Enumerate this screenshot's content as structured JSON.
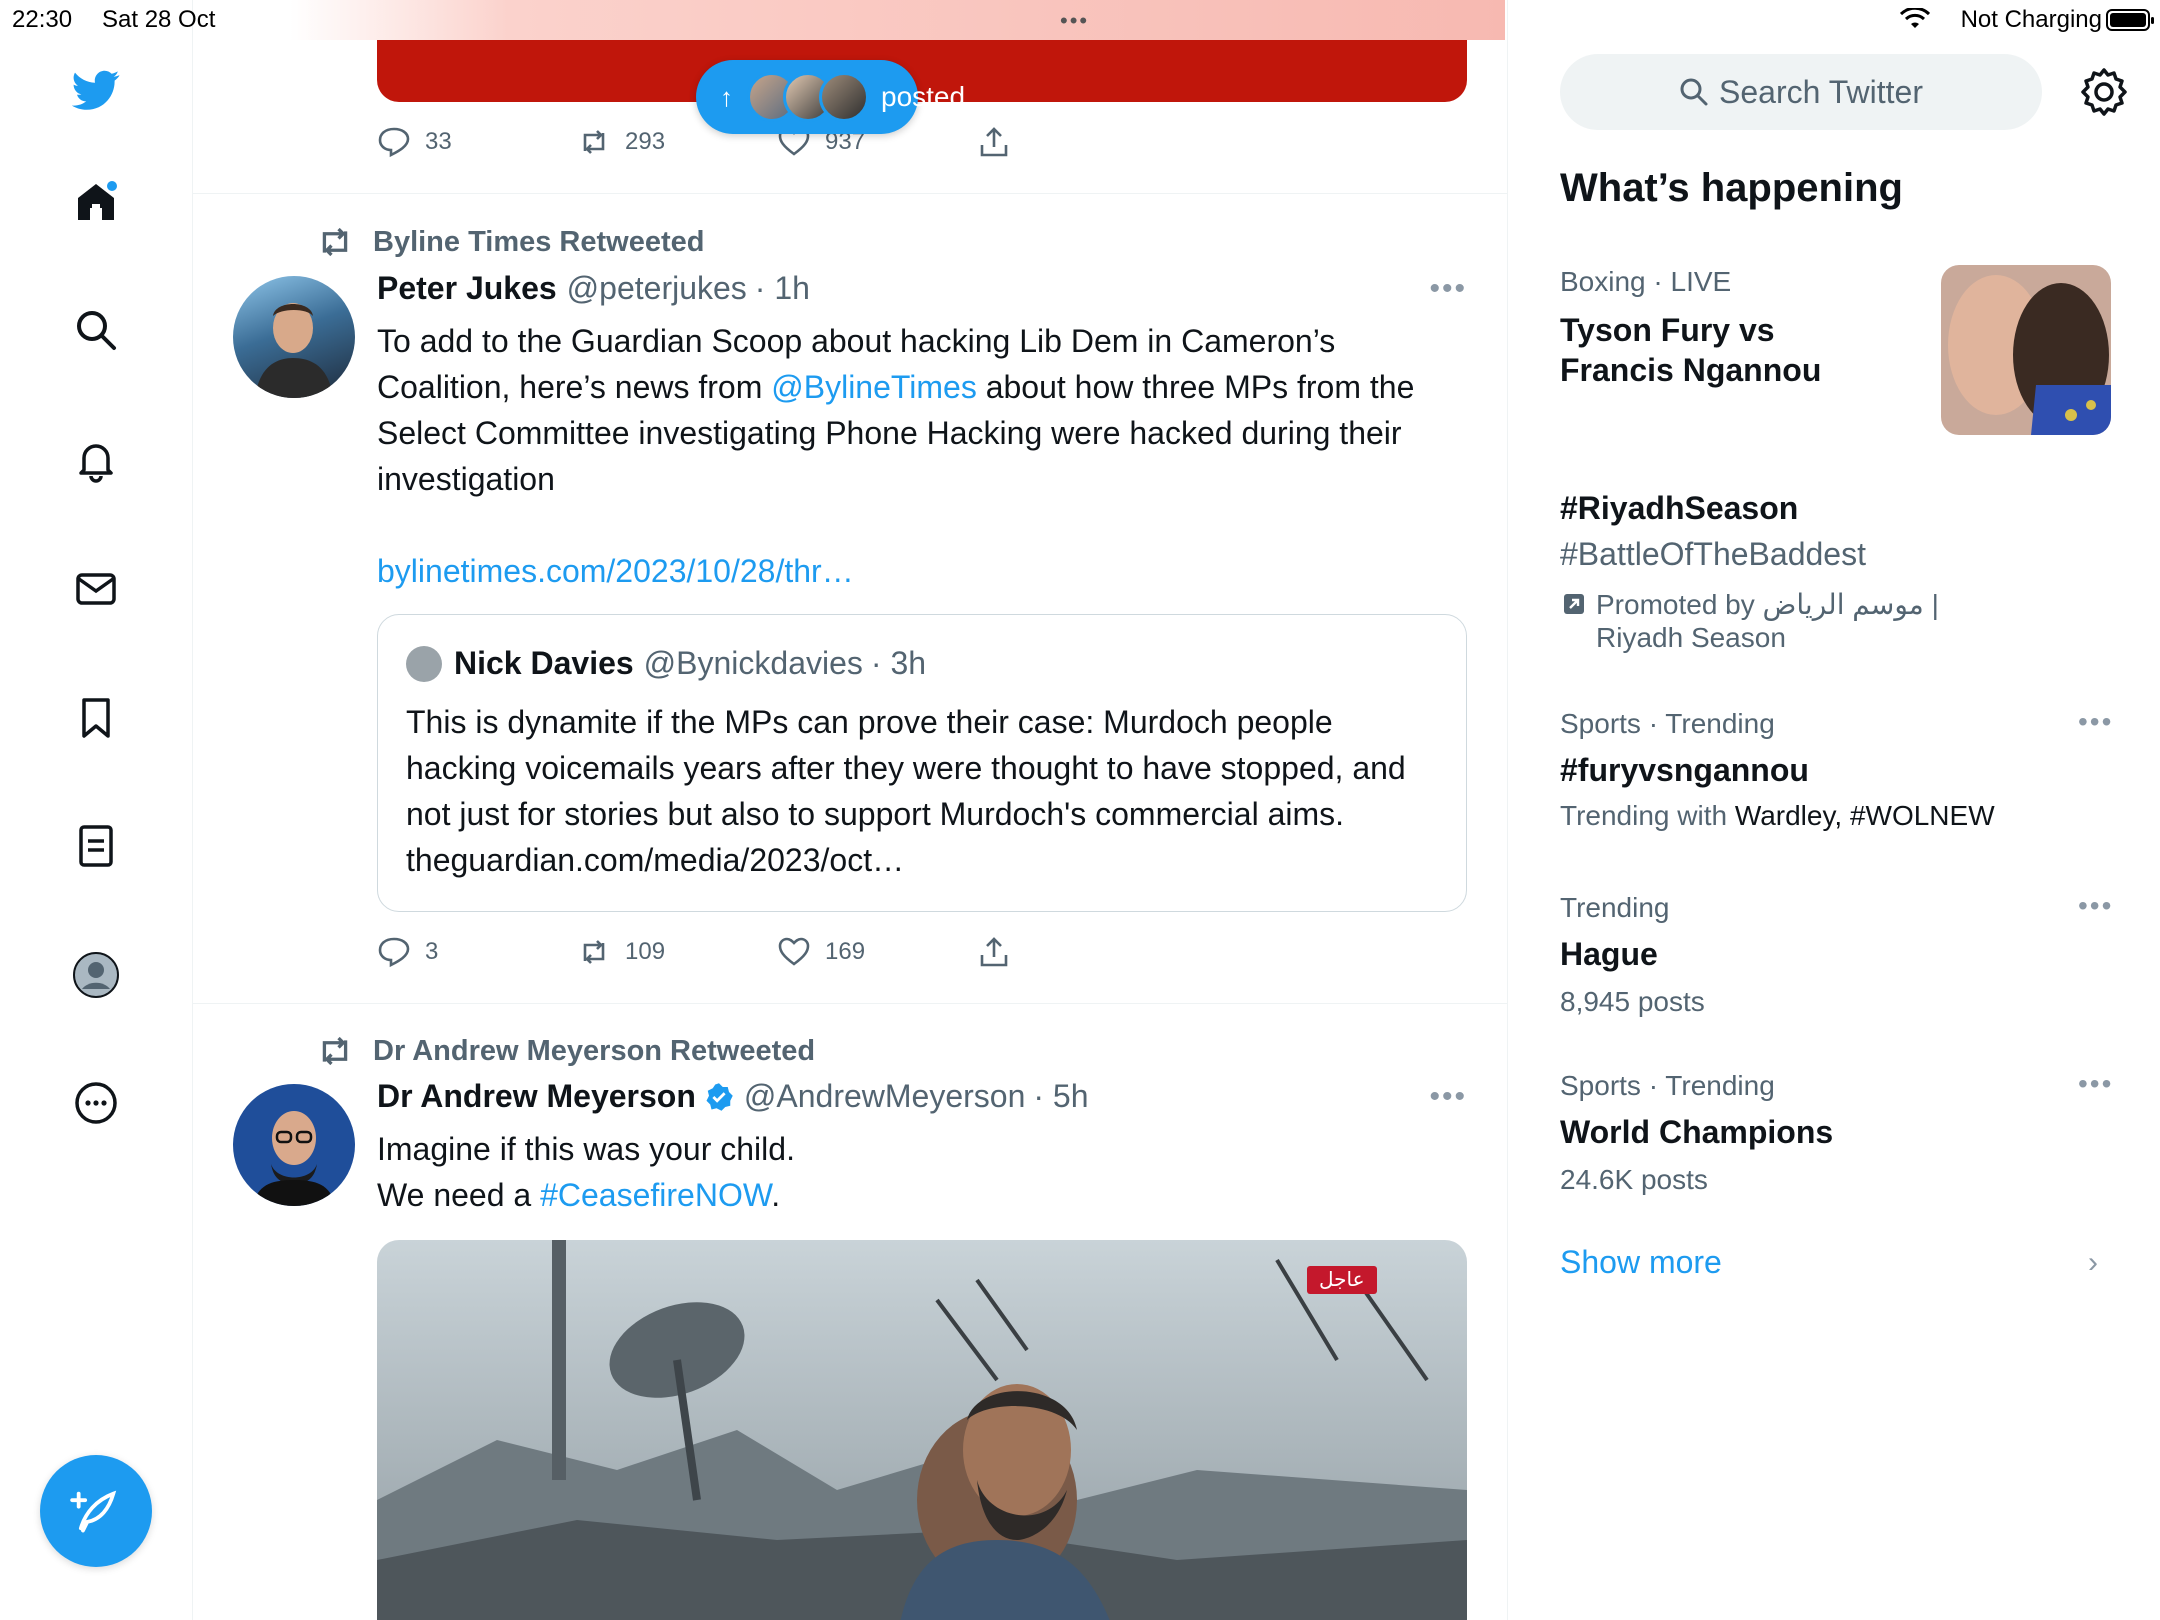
{
  "status_bar": {
    "time": "22:30",
    "date": "Sat 28 Oct",
    "charging": "Not Charging",
    "center_indicator": "•••"
  },
  "nav": {
    "icons": [
      "twitter-logo-icon",
      "home-icon",
      "search-icon",
      "bell-icon",
      "mail-icon",
      "bookmark-icon",
      "lists-icon",
      "profile-icon",
      "more-icon"
    ],
    "compose_icon": "compose-icon"
  },
  "banner": {
    "pill_arrow": "↑",
    "pill_label": "posted"
  },
  "prev_tweet_actions": {
    "replies": "33",
    "retweets": "293",
    "likes": "937"
  },
  "tweets": [
    {
      "retweeted_by": "Byline Times Retweeted",
      "name": "Peter Jukes",
      "handle": "@peterjukes",
      "time": "· 1h",
      "text_1": "To add to the Guardian Scoop about hacking Lib Dem in Cameron’s Coalition, here’s news from ",
      "mention": "@BylineTimes",
      "text_2": " about how three MPs from the Select Committee investigating Phone Hacking were hacked during their investigation",
      "link": "bylinetimes.com/2023/10/28/thr…",
      "quote": {
        "name": "Nick Davies",
        "handle": "@Bynickdavies",
        "time": "· 3h",
        "text": "This is dynamite if the MPs can prove their case: Murdoch people hacking voicemails years after they were thought to have stopped, and not just for stories but also to support Murdoch's commercial aims. theguardian.com/media/2023/oct…"
      },
      "replies": "3",
      "retweets": "109",
      "likes": "169"
    },
    {
      "retweeted_by": "Dr Andrew Meyerson Retweeted",
      "name": "Dr Andrew Meyerson",
      "handle": "@AndrewMeyerson",
      "time": "· 5h",
      "line_1": "Imagine if this was your child.",
      "line_2_pre": "We need a ",
      "hashtag": "#CeasefireNOW",
      "line_2_post": ".",
      "media_badge": "عاجل"
    }
  ],
  "sidebar": {
    "search_placeholder": "Search Twitter",
    "heading": "What’s happening",
    "trends": [
      {
        "meta": "Boxing · LIVE",
        "title_1": "Tyson Fury vs",
        "title_2": "Francis Ngannou"
      },
      {
        "title": "#RiyadhSeason",
        "subtitle": "#BattleOfTheBaddest",
        "promo_1": "Promoted by موسم الرياض |",
        "promo_2": "Riyadh Season"
      },
      {
        "meta": "Sports · Trending",
        "title": "#furyvsngannou",
        "sub_pre": "Trending with ",
        "sub_names": "Wardley, #WOLNEW"
      },
      {
        "meta": "Trending",
        "title": "Hague",
        "sub": "8,945 posts"
      },
      {
        "meta": "Sports · Trending",
        "title": "World Champions",
        "sub": "24.6K posts"
      }
    ],
    "show_more": "Show more"
  }
}
